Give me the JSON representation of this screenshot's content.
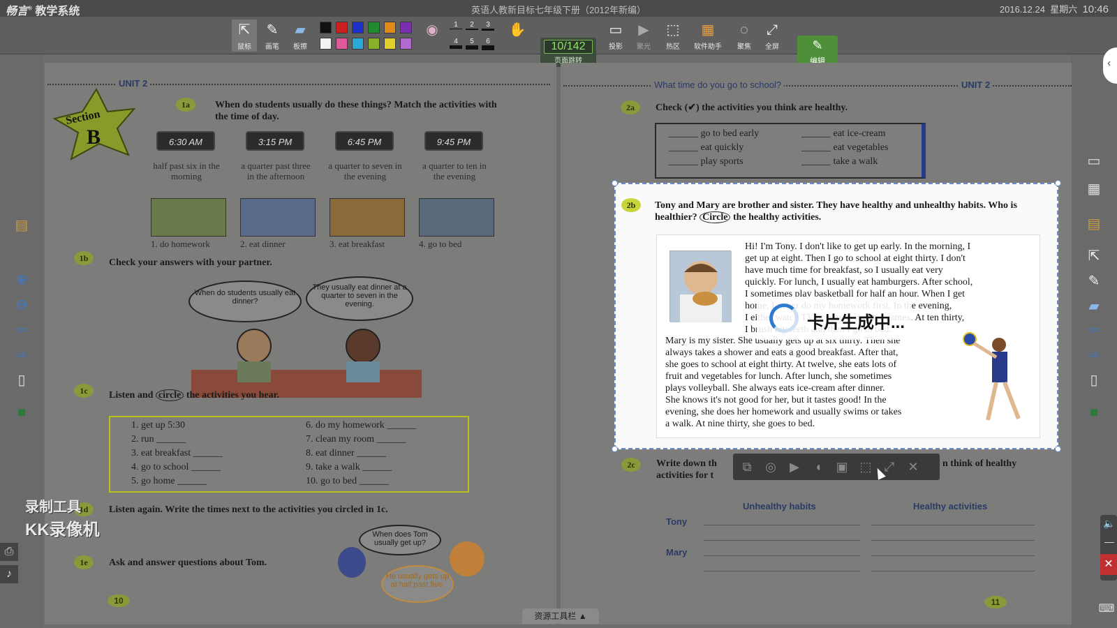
{
  "titlebar": {
    "logo": "畅言",
    "logo_suffix": "教学系统",
    "title": "英语人教新目标七年级下册（2012年新编）",
    "date": "2016.12.24",
    "weekday": "星期六",
    "time": "10:46"
  },
  "toolbar": {
    "mouse": "鼠标",
    "pen": "画笔",
    "eraser": "板擦",
    "page_counter": "10/142",
    "page_jump": "页面跳转",
    "projection": "投影",
    "spotlight": "聚光",
    "hotzone": "热区",
    "assistant": "软件助手",
    "gallery": "聚焦",
    "fullscreen": "全屏",
    "edit": "编辑",
    "line_widths": [
      "1",
      "2",
      "3",
      "4",
      "5",
      "6"
    ],
    "colors": [
      "#111111",
      "#cc1f1f",
      "#1f2fcc",
      "#1f8a2f",
      "#e08a1a",
      "#7a2fb0",
      "#f2f2f2",
      "#e05a9a",
      "#2aa8d8",
      "#8ab02a",
      "#e0d02a",
      "#b06ad0"
    ]
  },
  "left_page": {
    "unit": "UNIT 2",
    "section": "Section",
    "section_letter": "B",
    "ex1a": {
      "num": "1a",
      "text": "When do students usually do these things? Match the activities with the time of day.",
      "clocks": [
        "6:30 AM",
        "3:15 PM",
        "6:45 PM",
        "9:45 PM"
      ],
      "times": [
        "half past six in the morning",
        "a quarter past three in the afternoon",
        "a quarter to seven in the evening",
        "a quarter to ten in the evening"
      ],
      "pictures": [
        "1. do homework",
        "2. eat dinner",
        "3. eat breakfast",
        "4. go to bed"
      ]
    },
    "ex1b": {
      "num": "1b",
      "text": "Check your answers with your partner.",
      "bubble1": "When do students usually eat dinner?",
      "bubble2": "They usually eat dinner at a quarter to seven in the evening."
    },
    "ex1c": {
      "num": "1c",
      "text_before": "Listen and",
      "text_circle": "circle",
      "text_after": "the activities you hear.",
      "items_left": [
        "1. get up 5:30",
        "2. run ______",
        "3. eat breakfast ______",
        "4. go to school ______",
        "5. go home ______"
      ],
      "items_right": [
        "6. do my homework ______",
        "7. clean my room ______",
        "8. eat dinner ______",
        "9. take a walk ______",
        "10. go to bed ______"
      ]
    },
    "ex1d": {
      "num": "1d",
      "text": "Listen again. Write the times next to the activities you circled in 1c."
    },
    "ex1e": {
      "num": "1e",
      "text": "Ask and answer questions about Tom.",
      "bubble1": "When does Tom usually get up?",
      "bubble2": "He usually gets up at half past five."
    },
    "page_number": "10"
  },
  "watermark": {
    "line1": "录制工具",
    "line2": "KK录像机"
  },
  "right_page": {
    "header": "What time do you go to school?",
    "unit": "UNIT 2",
    "ex2a": {
      "num": "2a",
      "text": "Check (✔) the activities you think are healthy.",
      "items": [
        "______ go to bed early",
        "______ eat ice-cream",
        "______ eat quickly",
        "______ eat vegetables",
        "______ play sports",
        "______ take a walk"
      ]
    },
    "ex2b": {
      "num": "2b",
      "text_before": "Tony and Mary are brother and sister. They have healthy and unhealthy habits. Who is healthier?",
      "text_circle": "Circle",
      "text_after": "the healthy activities.",
      "tony_lines": [
        "Hi! I'm Tony. I don't like to get up early. In the morning, I",
        "get up at eight. Then I go to school at eight thirty. I don't",
        "have much time for breakfast, so I usually eat very",
        "quickly. For lunch, I usually eat hamburgers. After school,",
        "I sometimes play basketball for half an hour. When I get",
        "home, I never do my homework first. In the evening,",
        "I either watch TV or play computer games. At ten thirty,",
        "I brush my teeth and then I go to bed."
      ],
      "mary_lines": [
        "Mary is my sister. She usually gets up at six thirty. Then she",
        "always takes a shower and eats a good breakfast. After that,",
        "she goes to school at eight thirty. At twelve, she eats lots of",
        "fruit and vegetables for lunch. After lunch, she sometimes",
        "plays volleyball. She always eats ice-cream after dinner.",
        "She knows it's not good for her, but it tastes good! In the",
        "evening, she does her homework and usually swims or takes",
        "a walk. At nine thirty, she goes to bed."
      ]
    },
    "loading_text": "卡片生成中...",
    "ex2c": {
      "num": "2c",
      "text_left": "Write down th",
      "text_left2": "activities for t",
      "text_right": "n think of healthy",
      "col1": "Unhealthy habits",
      "col2": "Healthy activities",
      "row1": "Tony",
      "row2": "Mary"
    },
    "page_number": "11"
  },
  "bottom": {
    "resource_toolbar": "资源工具栏 ▲"
  }
}
